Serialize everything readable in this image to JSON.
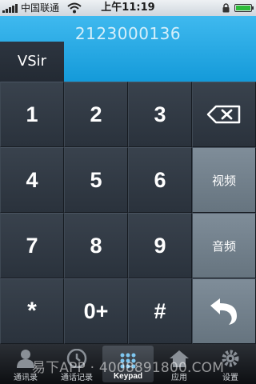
{
  "status_bar": {
    "carrier": "中国联通",
    "time": "上午11:19"
  },
  "display": {
    "number": "2123000136",
    "contact_button": "VSir"
  },
  "keypad": {
    "k1": "1",
    "k2": "2",
    "k3": "3",
    "k4": "4",
    "k5": "5",
    "k6": "6",
    "k7": "7",
    "k8": "8",
    "k9": "9",
    "star": "*",
    "zero": "0+",
    "hash": "#",
    "video": "视频",
    "audio": "音频"
  },
  "tabs": {
    "contacts": "通讯录",
    "calls": "通话记录",
    "keypad": "Keypad",
    "apps": "应用",
    "settings": "设置"
  },
  "watermark": "易下APP · 4008891800.COM",
  "colors": {
    "accent_blue": "#149ad9",
    "key_dark": "#2f3842",
    "key_gray": "#727f8b"
  }
}
